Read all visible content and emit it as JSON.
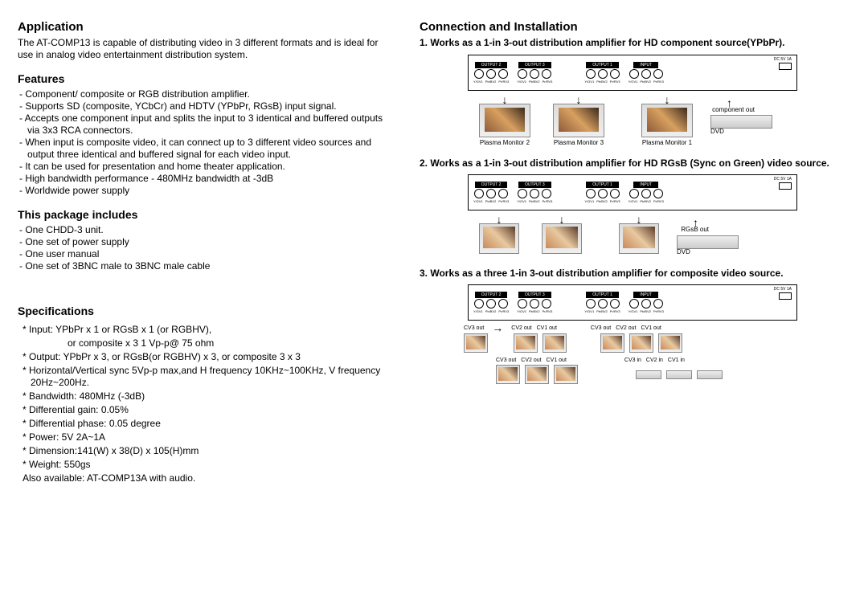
{
  "left": {
    "h_app": "Application",
    "app_text": "The AT-COMP13 is capable of distributing video in 3 different  formats and is ideal for use in analog video entertainment distribution system.",
    "h_feat": "Features",
    "features": [
      "- Component/ composite or RGB distribution amplifier.",
      "- Supports SD (composite, YCbCr) and HDTV (YPbPr, RGsB) input signal.",
      "- Accepts one component input and splits the input to 3 identical and buffered outputs via 3x3 RCA connectors.",
      "- When input is composite video, it can connect up to 3 different video sources and output three identical and buffered signal for each video input.",
      "- It can be used for presentation and home theater application.",
      "- High bandwidth performance - 480MHz bandwidth at -3dB",
      "- Worldwide power supply"
    ],
    "h_pkg": "This package includes",
    "package": [
      "- One CHDD-3 unit.",
      "- One set of power supply",
      "- One user manual",
      "- One set of 3BNC male to 3BNC male cable"
    ],
    "h_spec": "Specifications",
    "spec1": "* Input: YPbPr x 1 or RGsB x 1 (or RGBHV),",
    "spec1b": "or composite x 3  1 Vp-p@ 75 ohm",
    "spec2": "* Output: YPbPr x 3, or RGsB(or RGBHV) x 3, or composite 3 x 3",
    "spec3": "* Horizontal/Vertical sync 5Vp-p max,and H frequency 10KHz~100KHz, V frequency 20Hz~200Hz.",
    "spec4": "* Bandwidth: 480MHz (-3dB)",
    "spec5": "* Differential gain: 0.05%",
    "spec6": "* Differential phase: 0.05 degree",
    "spec7": "* Power: 5V 2A~1A",
    "spec8": "* Dimension:141(W) x 38(D) x 105(H)mm",
    "spec9": "* Weight: 550gs",
    "spec10": "Also available: AT-COMP13A with audio."
  },
  "right": {
    "h_conn": "Connection and Installation",
    "mode1": "1. Works as a 1-in 3-out distribution amplifier for HD component source(YPbPr).",
    "mode2": "2. Works as a 1-in 3-out distribution amplifier for HD RGsB (Sync on Green) video source.",
    "mode3": "3. Works as a three 1-in 3-out distribution amplifier for composite video source.",
    "panel": {
      "out2": "OUTPUT 2",
      "out3": "OUTPUT 3",
      "out1": "OUTPUT 1",
      "in": "INPUT",
      "dc": "DC 5V 1A",
      "j1": "Y/GV1",
      "j2": "Pb/BV2",
      "j3": "Pr/RV3"
    },
    "labels": {
      "pm1": "Plasma Monitor 1",
      "pm2": "Plasma Monitor 2",
      "pm3": "Plasma Monitor 3",
      "dvd": "DVD",
      "comp": "component out",
      "rgsb": "RGsB out",
      "cvin": [
        "CV3 in",
        "CV2 in",
        "CV1 in"
      ],
      "cvout": [
        "CV3 out",
        "CV2 out",
        "CV1 out"
      ]
    }
  }
}
